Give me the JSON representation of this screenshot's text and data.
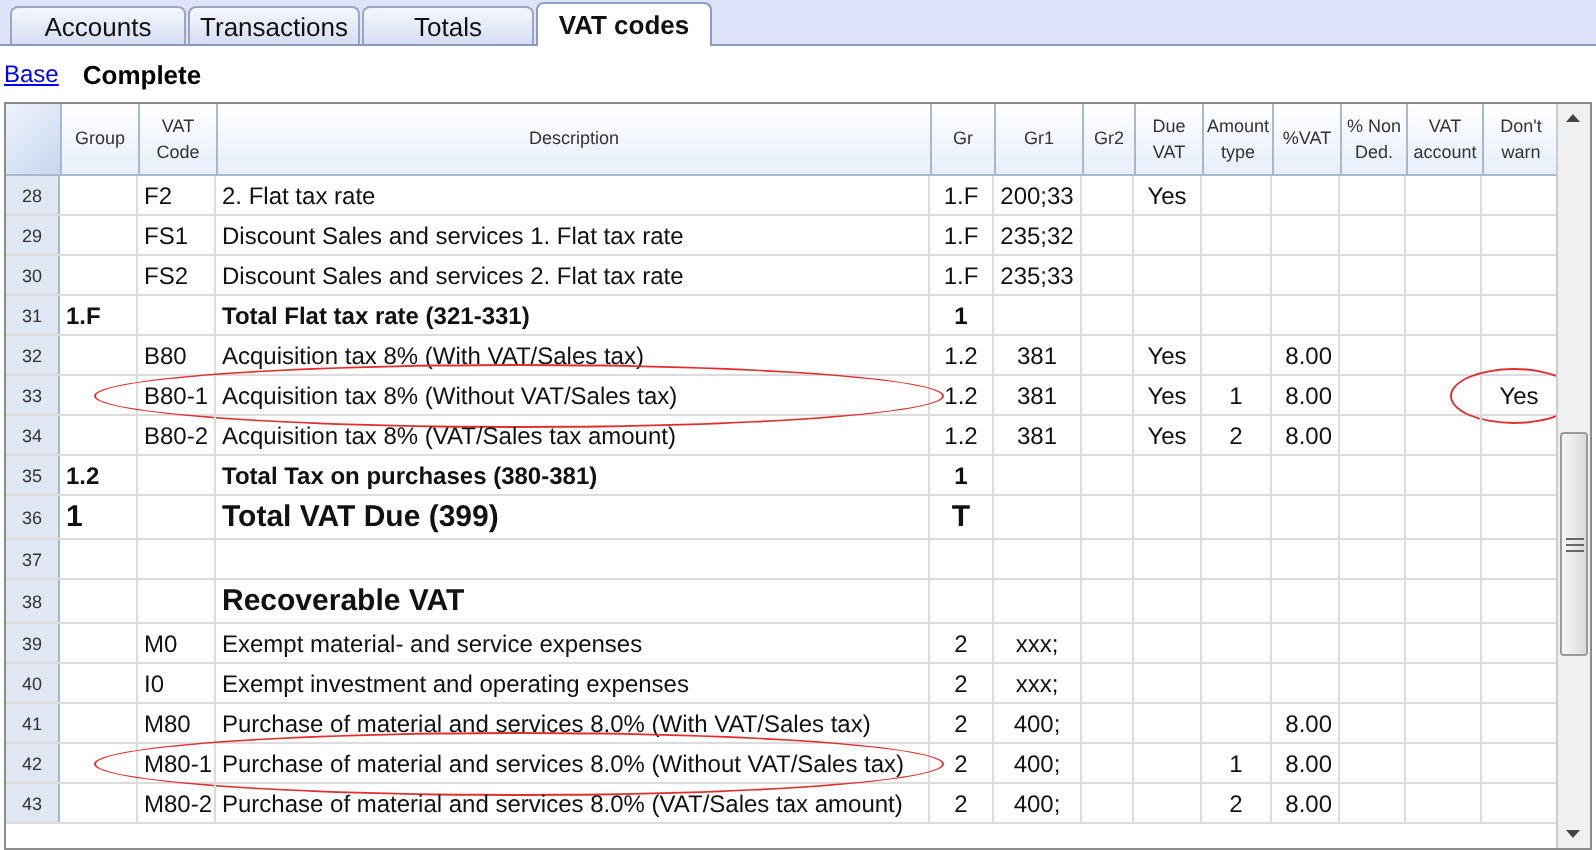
{
  "tabs": [
    {
      "label": "Accounts",
      "selected": false
    },
    {
      "label": "Transactions",
      "selected": false
    },
    {
      "label": "Totals",
      "selected": false
    },
    {
      "label": "VAT codes",
      "selected": true
    }
  ],
  "views": [
    {
      "label": "Base",
      "selected": false
    },
    {
      "label": "Complete",
      "selected": true
    }
  ],
  "table": {
    "columns": [
      "Group",
      "VAT Code",
      "Description",
      "Gr",
      "Gr1",
      "Gr2",
      "Due VAT",
      "Amount type",
      "%VAT",
      "% Non Ded.",
      "VAT account",
      "Don't warn"
    ],
    "rows": [
      {
        "num": "28",
        "kind": "normal",
        "code": "F2",
        "description": "2. Flat tax rate",
        "gr": "1.F",
        "gr1": "200;33",
        "due_vat": "Yes",
        "circled": false,
        "warn_circled": false
      },
      {
        "num": "29",
        "kind": "normal",
        "code": "FS1",
        "description": "Discount Sales and services 1. Flat tax rate",
        "gr": "1.F",
        "gr1": "235;32",
        "circled": false,
        "warn_circled": false
      },
      {
        "num": "30",
        "kind": "normal",
        "code": "FS2",
        "description": "Discount Sales and services 2. Flat tax rate",
        "gr": "1.F",
        "gr1": "235;33",
        "circled": false,
        "warn_circled": false
      },
      {
        "num": "31",
        "kind": "subtotal",
        "group": "1.F",
        "description": "Total Flat tax rate  (321-331)",
        "gr": "1",
        "circled": false,
        "warn_circled": false
      },
      {
        "num": "32",
        "kind": "normal",
        "code": "B80",
        "description": "Acquisition tax 8% (With VAT/Sales tax)",
        "gr": "1.2",
        "gr1": "381",
        "due_vat": "Yes",
        "vat_pct": "8.00",
        "circled": false,
        "warn_circled": false
      },
      {
        "num": "33",
        "kind": "normal",
        "code": "B80-1",
        "description": "Acquisition tax 8% (Without VAT/Sales tax)",
        "gr": "1.2",
        "gr1": "381",
        "due_vat": "Yes",
        "amount_type": "1",
        "vat_pct": "8.00",
        "dont_warn": "Yes",
        "circled": true,
        "warn_circled": true
      },
      {
        "num": "34",
        "kind": "normal",
        "code": "B80-2",
        "description": "Acquisition tax 8% (VAT/Sales tax amount)",
        "gr": "1.2",
        "gr1": "381",
        "due_vat": "Yes",
        "amount_type": "2",
        "vat_pct": "8.00",
        "circled": false,
        "warn_circled": false
      },
      {
        "num": "35",
        "kind": "subtotal",
        "group": "1.2",
        "description": "Total Tax on purchases (380-381)",
        "gr": "1",
        "circled": false,
        "warn_circled": false
      },
      {
        "num": "36",
        "kind": "total",
        "group": "1",
        "description": "Total VAT Due (399)",
        "gr": "T",
        "circled": false,
        "warn_circled": false
      },
      {
        "num": "37",
        "kind": "normal",
        "circled": false,
        "warn_circled": false
      },
      {
        "num": "38",
        "kind": "heading",
        "description": "Recoverable VAT",
        "circled": false,
        "warn_circled": false
      },
      {
        "num": "39",
        "kind": "normal",
        "code": "M0",
        "description": "Exempt material- and service expenses",
        "gr": "2",
        "gr1": "xxx;",
        "circled": false,
        "warn_circled": false
      },
      {
        "num": "40",
        "kind": "normal",
        "code": "I0",
        "description": "Exempt investment and operating expenses",
        "gr": "2",
        "gr1": "xxx;",
        "circled": false,
        "warn_circled": false
      },
      {
        "num": "41",
        "kind": "normal",
        "code": "M80",
        "description": "Purchase of material and services 8.0% (With VAT/Sales tax)",
        "gr": "2",
        "gr1": "400;",
        "vat_pct": "8.00",
        "circled": false,
        "warn_circled": false
      },
      {
        "num": "42",
        "kind": "normal",
        "code": "M80-1",
        "description": "Purchase of material and services 8.0% (Without VAT/Sales tax)",
        "gr": "2",
        "gr1": "400;",
        "amount_type": "1",
        "vat_pct": "8.00",
        "circled": true,
        "warn_circled": false
      },
      {
        "num": "43",
        "kind": "normal",
        "code": "M80-2",
        "description": "Purchase of material and services 8.0% (VAT/Sales tax amount)",
        "gr": "2",
        "gr1": "400;",
        "amount_type": "2",
        "vat_pct": "8.00",
        "circled": false,
        "warn_circled": false
      }
    ]
  }
}
